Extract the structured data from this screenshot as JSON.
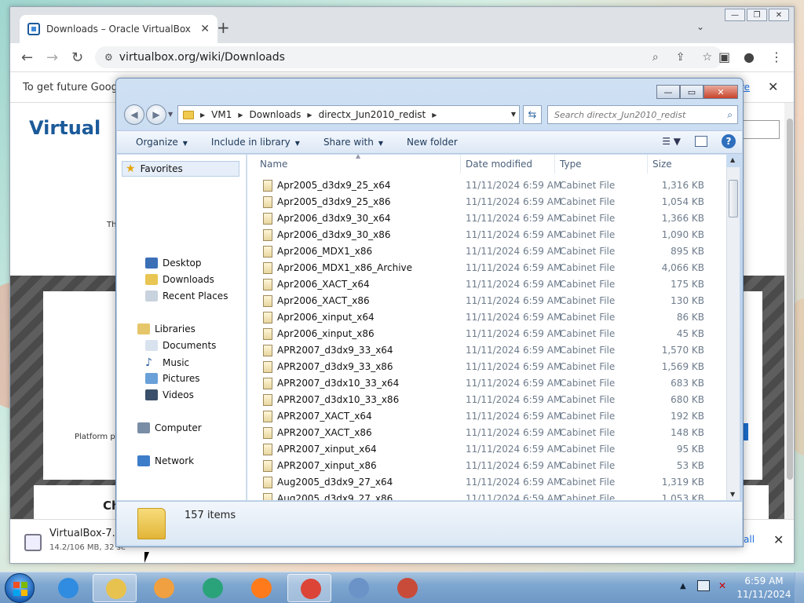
{
  "browser": {
    "tab_title": "Downloads – Oracle VirtualBox",
    "tab_close": "✕",
    "new_tab": "+",
    "url": "virtualbox.org/wiki/Downloads",
    "infobar_text": "To get future Google",
    "infobar_link": "re",
    "page": {
      "logo_text": "Virtual",
      "th_text": "Th",
      "platform_text": "Platform p",
      "ch_text": "Ch",
      "blue_chip": "d"
    },
    "download": {
      "filename": "VirtualBox-7.1.",
      "status": "14.2/106 MB, 32 se",
      "show_all": "all"
    }
  },
  "explorer": {
    "breadcrumb": [
      "VM1",
      "Downloads",
      "directx_Jun2010_redist"
    ],
    "search_placeholder": "Search directx_Jun2010_redist",
    "commands": [
      "Organize",
      "Include in library",
      "Share with",
      "New folder"
    ],
    "nav": {
      "favorites": "Favorites",
      "desktop": "Desktop",
      "downloads": "Downloads",
      "recent": "Recent Places",
      "libraries": "Libraries",
      "documents": "Documents",
      "music": "Music",
      "pictures": "Pictures",
      "videos": "Videos",
      "computer": "Computer",
      "network": "Network"
    },
    "columns": {
      "name": "Name",
      "date": "Date modified",
      "type": "Type",
      "size": "Size"
    },
    "files": [
      {
        "name": "Apr2005_d3dx9_25_x64",
        "date": "11/11/2024 6:59 AM",
        "type": "Cabinet File",
        "size": "1,316 KB"
      },
      {
        "name": "Apr2005_d3dx9_25_x86",
        "date": "11/11/2024 6:59 AM",
        "type": "Cabinet File",
        "size": "1,054 KB"
      },
      {
        "name": "Apr2006_d3dx9_30_x64",
        "date": "11/11/2024 6:59 AM",
        "type": "Cabinet File",
        "size": "1,366 KB"
      },
      {
        "name": "Apr2006_d3dx9_30_x86",
        "date": "11/11/2024 6:59 AM",
        "type": "Cabinet File",
        "size": "1,090 KB"
      },
      {
        "name": "Apr2006_MDX1_x86",
        "date": "11/11/2024 6:59 AM",
        "type": "Cabinet File",
        "size": "895 KB"
      },
      {
        "name": "Apr2006_MDX1_x86_Archive",
        "date": "11/11/2024 6:59 AM",
        "type": "Cabinet File",
        "size": "4,066 KB"
      },
      {
        "name": "Apr2006_XACT_x64",
        "date": "11/11/2024 6:59 AM",
        "type": "Cabinet File",
        "size": "175 KB"
      },
      {
        "name": "Apr2006_XACT_x86",
        "date": "11/11/2024 6:59 AM",
        "type": "Cabinet File",
        "size": "130 KB"
      },
      {
        "name": "Apr2006_xinput_x64",
        "date": "11/11/2024 6:59 AM",
        "type": "Cabinet File",
        "size": "86 KB"
      },
      {
        "name": "Apr2006_xinput_x86",
        "date": "11/11/2024 6:59 AM",
        "type": "Cabinet File",
        "size": "45 KB"
      },
      {
        "name": "APR2007_d3dx9_33_x64",
        "date": "11/11/2024 6:59 AM",
        "type": "Cabinet File",
        "size": "1,570 KB"
      },
      {
        "name": "APR2007_d3dx9_33_x86",
        "date": "11/11/2024 6:59 AM",
        "type": "Cabinet File",
        "size": "1,569 KB"
      },
      {
        "name": "APR2007_d3dx10_33_x64",
        "date": "11/11/2024 6:59 AM",
        "type": "Cabinet File",
        "size": "683 KB"
      },
      {
        "name": "APR2007_d3dx10_33_x86",
        "date": "11/11/2024 6:59 AM",
        "type": "Cabinet File",
        "size": "680 KB"
      },
      {
        "name": "APR2007_XACT_x64",
        "date": "11/11/2024 6:59 AM",
        "type": "Cabinet File",
        "size": "192 KB"
      },
      {
        "name": "APR2007_XACT_x86",
        "date": "11/11/2024 6:59 AM",
        "type": "Cabinet File",
        "size": "148 KB"
      },
      {
        "name": "APR2007_xinput_x64",
        "date": "11/11/2024 6:59 AM",
        "type": "Cabinet File",
        "size": "95 KB"
      },
      {
        "name": "APR2007_xinput_x86",
        "date": "11/11/2024 6:59 AM",
        "type": "Cabinet File",
        "size": "53 KB"
      },
      {
        "name": "Aug2005_d3dx9_27_x64",
        "date": "11/11/2024 6:59 AM",
        "type": "Cabinet File",
        "size": "1,319 KB"
      },
      {
        "name": "Aug2005_d3dx9_27_x86",
        "date": "11/11/2024 6:59 AM",
        "type": "Cabinet File",
        "size": "1,053 KB"
      }
    ],
    "items_count": "157 items"
  },
  "taskbar": {
    "apps": [
      "internet-explorer",
      "file-explorer",
      "media-player",
      "edge",
      "firefox",
      "chrome",
      "control-panel",
      "virtualbox"
    ],
    "time": "6:59 AM",
    "date": "11/11/2024"
  },
  "colors": {
    "explorer_frame": "#b9d1ec",
    "link_blue": "#1a73e8",
    "taskbar": "#7ea6d0"
  }
}
